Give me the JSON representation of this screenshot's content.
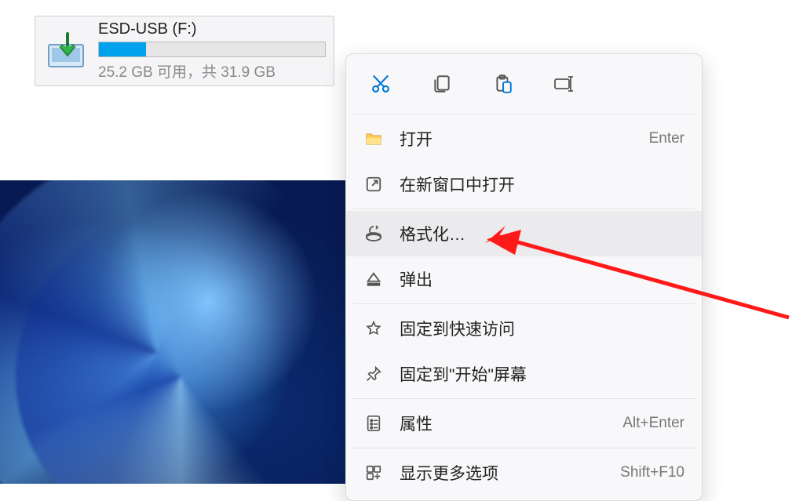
{
  "drive": {
    "name": "ESD-USB (F:)",
    "storage_text": "25.2 GB 可用，共 31.9 GB",
    "used_percent": 21
  },
  "context_menu": {
    "toolbar": {
      "cut": "cut",
      "copy": "copy",
      "paste": "paste",
      "rename": "rename"
    },
    "items": [
      {
        "icon": "open-folder-icon",
        "label": "打开",
        "shortcut": "Enter"
      },
      {
        "icon": "open-new-window-icon",
        "label": "在新窗口中打开",
        "shortcut": ""
      },
      {
        "icon": "format-icon",
        "label": "格式化…",
        "shortcut": "",
        "highlight": true
      },
      {
        "icon": "eject-icon",
        "label": "弹出",
        "shortcut": ""
      },
      {
        "icon": "pin-quick-access-icon",
        "label": "固定到快速访问",
        "shortcut": ""
      },
      {
        "icon": "pin-start-icon",
        "label": "固定到\"开始\"屏幕",
        "shortcut": ""
      },
      {
        "icon": "properties-icon",
        "label": "属性",
        "shortcut": "Alt+Enter"
      },
      {
        "icon": "more-options-icon",
        "label": "显示更多选项",
        "shortcut": "Shift+F10"
      }
    ]
  }
}
